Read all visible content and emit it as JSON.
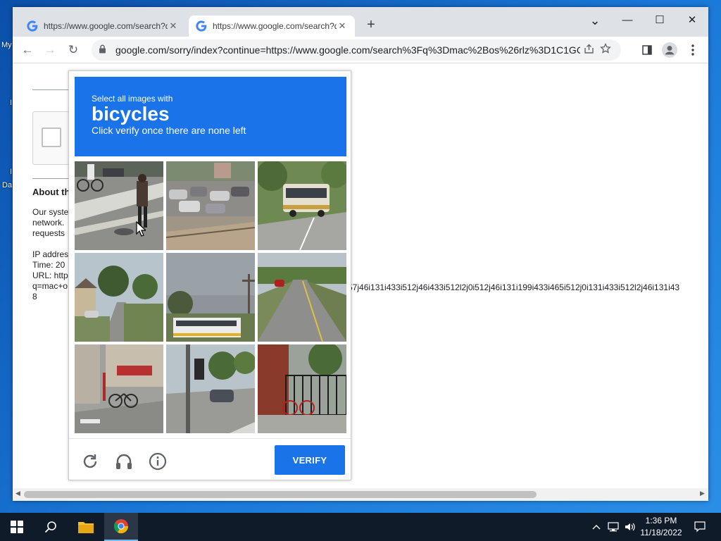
{
  "desktop": {
    "fragments": [
      "My",
      "I",
      "I",
      "Da"
    ]
  },
  "browser": {
    "tabs": [
      {
        "title": "https://www.google.com/search?q",
        "close": "✕"
      },
      {
        "title": "https://www.google.com/search?q",
        "close": "✕"
      }
    ],
    "new_tab": "+",
    "window_controls": {
      "tabsearch": "⌄",
      "minimize": "—",
      "maximize": "☐",
      "close": "✕"
    },
    "url": "google.com/sorry/index?continue=https://www.google.com/search%3Fq%3Dmac%2Bos%26rlz%3D1C1GC...",
    "nav": {
      "back": "←",
      "forward": "→",
      "reload": "↻"
    }
  },
  "page": {
    "about_heading": "About th",
    "body_lines": [
      "Our syste",
      "network.",
      "requests"
    ],
    "info_lines": [
      "IP addres",
      "Time: 20",
      "URL: http",
      "q=mac+o",
      "8"
    ],
    "url_tail": "57j46i131i433i512j46i433i512l2j0i512j46i131i199i433i465i512j0i131i433i512l2j46i131i43"
  },
  "captcha": {
    "instruction_line1": "Select all images with",
    "target_word": "bicycles",
    "instruction_line3": "Click verify once there are none left",
    "verify_label": "VERIFY",
    "tiles": [
      "street crossing with cyclist",
      "parking lot with cars",
      "street with bus",
      "residential street",
      "school bus and trees",
      "road with car",
      "street with bicycle",
      "intersection with traffic light",
      "fence with bicycle"
    ]
  },
  "taskbar": {
    "time": "1:36 PM",
    "date": "11/18/2022"
  },
  "colors": {
    "accent": "#1a73e8",
    "tabbar": "#dee1e6",
    "taskbar": "#101b2a"
  }
}
